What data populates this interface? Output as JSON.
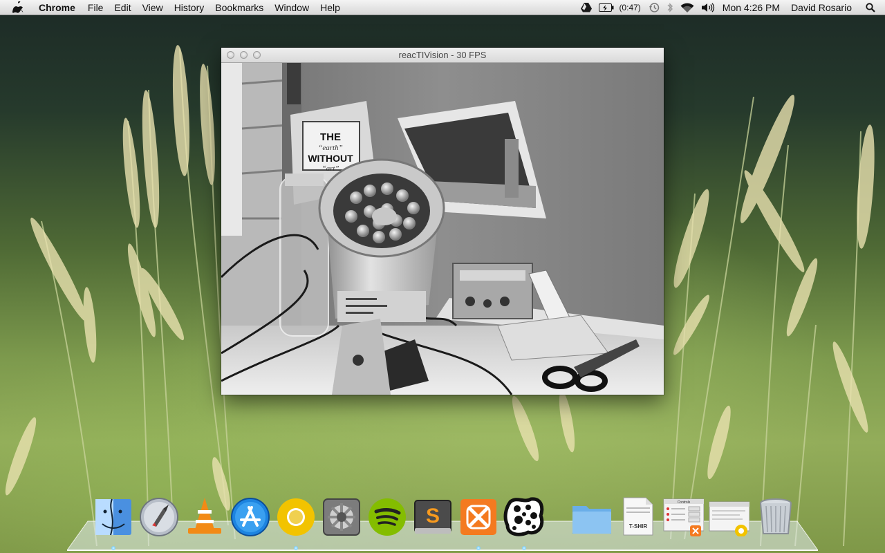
{
  "menubar": {
    "apple_icon": "apple-logo-icon",
    "app_name": "Chrome",
    "items": [
      "File",
      "Edit",
      "View",
      "History",
      "Bookmarks",
      "Window",
      "Help"
    ],
    "battery_time": "(0:47)",
    "clock": "Mon 4:26 PM",
    "user": "David Rosario",
    "status_icons": [
      "google-drive-icon",
      "battery-icon",
      "time-machine-icon",
      "bluetooth-icon",
      "wifi-icon",
      "volume-icon",
      "spotlight-icon"
    ]
  },
  "window": {
    "title": "reacTIVision - 30 FPS",
    "camera_feed": {
      "poster_text": [
        "THE",
        "“earth”",
        "WITHOUT",
        "“art”"
      ]
    }
  },
  "dock": {
    "items": [
      {
        "name": "Finder",
        "icon": "finder-icon",
        "running": true
      },
      {
        "name": "Launchpad",
        "icon": "launchpad-icon",
        "running": false
      },
      {
        "name": "VLC",
        "icon": "vlc-icon",
        "running": false
      },
      {
        "name": "App Store",
        "icon": "app-store-icon",
        "running": false
      },
      {
        "name": "Chrome",
        "icon": "chrome-icon",
        "running": true
      },
      {
        "name": "System Preferences",
        "icon": "system-preferences-icon",
        "running": false
      },
      {
        "name": "Spotify",
        "icon": "spotify-icon",
        "running": false
      },
      {
        "name": "Sublime Text",
        "icon": "sublime-text-icon",
        "running": false
      },
      {
        "name": "XAMPP",
        "icon": "xampp-icon",
        "running": true
      },
      {
        "name": "reacTIVision",
        "icon": "reactivision-icon",
        "running": true
      },
      {
        "name": "Folder",
        "icon": "folder-icon",
        "running": false
      },
      {
        "name": "Document",
        "icon": "document-icon",
        "running": false,
        "label": "T-SHIR"
      },
      {
        "name": "XAMPP Control",
        "icon": "xampp-control-icon",
        "running": false,
        "label": "Controls"
      },
      {
        "name": "Chrome Window",
        "icon": "chrome-window-icon",
        "running": false
      },
      {
        "name": "Trash",
        "icon": "trash-icon",
        "running": false
      }
    ]
  },
  "colors": {
    "menubar_bg": "#e6e6e6",
    "vlc_orange": "#f28a16",
    "spotify_green": "#84bd00",
    "xampp_orange": "#f47a20",
    "appstore_blue": "#1d84e0",
    "chrome_yellow": "#f2c300"
  }
}
